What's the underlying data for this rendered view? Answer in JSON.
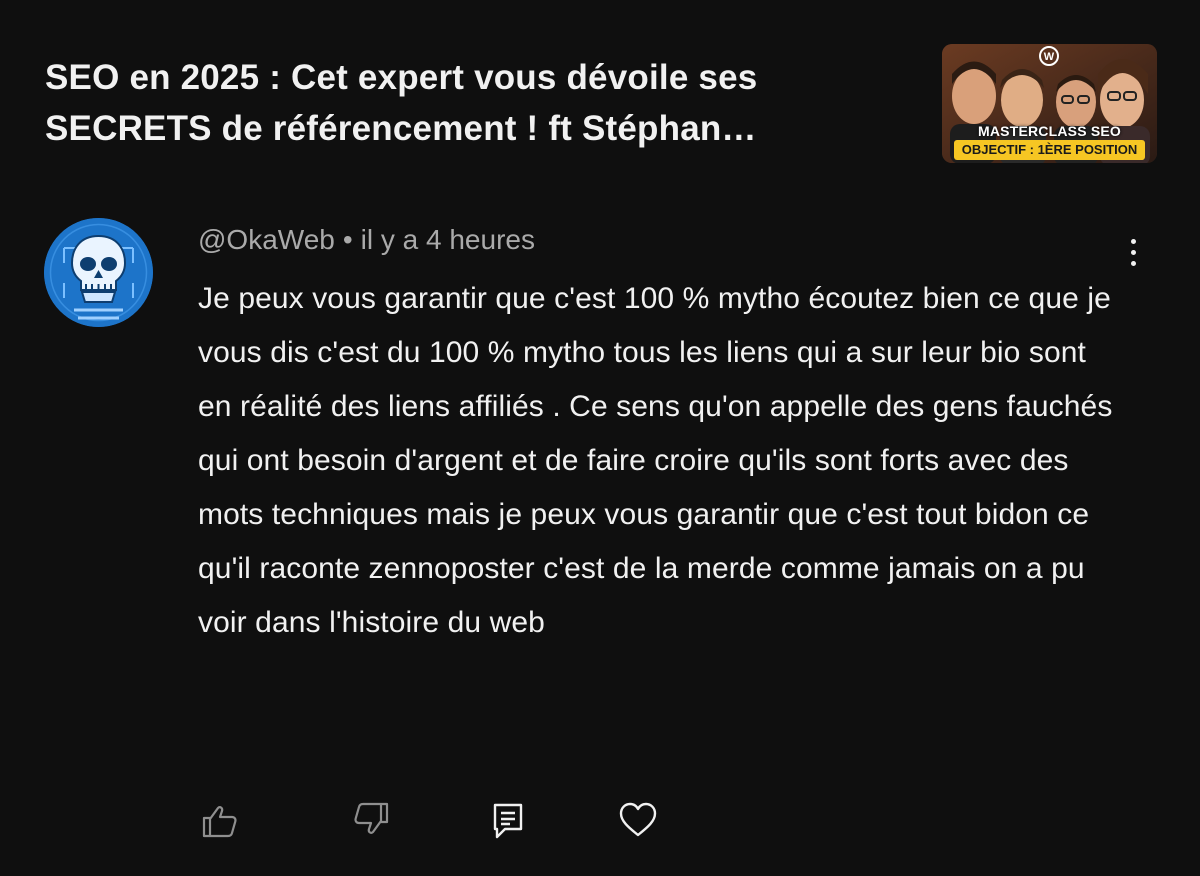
{
  "video": {
    "title": "SEO en 2025 : Cet expert vous dévoile ses SECRETS de référencement ! ft Stéphan…",
    "thumbnail": {
      "brand_mark": "W",
      "line1": "MASTERCLASS SEO",
      "line2": "OBJECTIF : 1ÈRE POSITION",
      "accent_color": "#f6c623"
    }
  },
  "comment": {
    "author": "@OkaWeb",
    "separator": "•",
    "time": "il y a 4 heures",
    "text": "Je peux vous garantir que c'est 100 % mytho écoutez bien ce que je vous dis c'est du 100 % mytho tous les liens qui a sur leur bio sont en réalité des liens affiliés . Ce sens qu'on appelle des gens fauchés qui ont besoin d'argent et de faire croire qu'ils sont forts avec des mots techniques mais je peux vous garantir que c'est tout bidon ce qu'il raconte zennoposter c'est de la merde comme jamais on a pu voir dans l'histoire du web",
    "avatar_icon": "skull-icon",
    "avatar_color": "#1d74c9"
  },
  "actions": {
    "icons": [
      "thumbs-up-icon",
      "thumbs-down-icon",
      "reply-icon",
      "heart-icon"
    ]
  },
  "theme": {
    "background": "#0f0f0f",
    "text": "#f1f1f1",
    "muted": "#aaaaaa"
  }
}
